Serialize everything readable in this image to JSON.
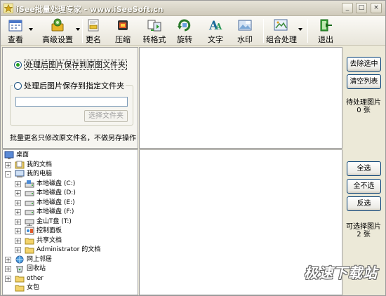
{
  "window": {
    "title": "iSee批量处理专家 - www.iSeeSoft.cn",
    "controls": [
      "_",
      "□",
      "×"
    ]
  },
  "toolbar": {
    "items": [
      {
        "label": "查看",
        "icon": "calendar-view-icon"
      },
      {
        "label": "高级设置",
        "icon": "advanced-settings-icon"
      },
      {
        "label": "更名",
        "icon": "rename-icon"
      },
      {
        "label": "压缩",
        "icon": "compress-icon"
      },
      {
        "label": "转格式",
        "icon": "convert-format-icon"
      },
      {
        "label": "旋转",
        "icon": "rotate-icon"
      },
      {
        "label": "文字",
        "icon": "text-icon"
      },
      {
        "label": "水印",
        "icon": "watermark-icon"
      },
      {
        "label": "组合处理",
        "icon": "combo-process-icon"
      },
      {
        "label": "退出",
        "icon": "exit-icon"
      }
    ]
  },
  "options": {
    "radio_original": "处理后图片保存到原图文件夹",
    "radio_custom": "处理后图片保存到指定文件夹",
    "path_value": "",
    "choose_folder": "选择文件夹",
    "rename_note": "批量更名只修改原文件名，不做另存操作"
  },
  "side_top": {
    "remove_selected": "去除选中",
    "clear_list": "清空列表",
    "pending_label": "待处理图片",
    "pending_count": "0 张"
  },
  "side_bottom": {
    "select_all": "全选",
    "select_none": "全不选",
    "invert": "反选",
    "selectable_label": "可选择图片",
    "selectable_count": "2 张"
  },
  "tree": {
    "nodes": [
      {
        "label": "桌面",
        "icon": "desktop-icon",
        "level": 0,
        "expander": ""
      },
      {
        "label": "我的文档",
        "icon": "my-documents-icon",
        "level": 1,
        "expander": "+"
      },
      {
        "label": "我的电脑",
        "icon": "my-computer-icon",
        "level": 1,
        "expander": "-"
      },
      {
        "label": "本地磁盘 (C:)",
        "icon": "drive-c-icon",
        "level": 2,
        "expander": "+"
      },
      {
        "label": "本地磁盘 (D:)",
        "icon": "drive-icon",
        "level": 2,
        "expander": "+"
      },
      {
        "label": "本地磁盘 (E:)",
        "icon": "drive-icon",
        "level": 2,
        "expander": "+"
      },
      {
        "label": "本地磁盘 (F:)",
        "icon": "drive-icon",
        "level": 2,
        "expander": "+"
      },
      {
        "label": "金山T盘 (T:)",
        "icon": "network-drive-icon",
        "level": 2,
        "expander": "+"
      },
      {
        "label": "控制面板",
        "icon": "control-panel-icon",
        "level": 2,
        "expander": "+"
      },
      {
        "label": "共享文档",
        "icon": "folder-icon",
        "level": 2,
        "expander": "+"
      },
      {
        "label": "Administrator 的文档",
        "icon": "folder-icon",
        "level": 2,
        "expander": "+"
      },
      {
        "label": "网上邻居",
        "icon": "network-icon",
        "level": 1,
        "expander": "+"
      },
      {
        "label": "回收站",
        "icon": "recycle-bin-icon",
        "level": 1,
        "expander": "+"
      },
      {
        "label": "other",
        "icon": "folder-icon",
        "level": 1,
        "expander": "+"
      },
      {
        "label": "女包",
        "icon": "folder-icon",
        "level": 1,
        "expander": ""
      }
    ]
  },
  "watermark": "极速下载站",
  "colors": {
    "accent": "#21a121",
    "window_bg": "#ece9d8",
    "button_border": "#003c74"
  }
}
